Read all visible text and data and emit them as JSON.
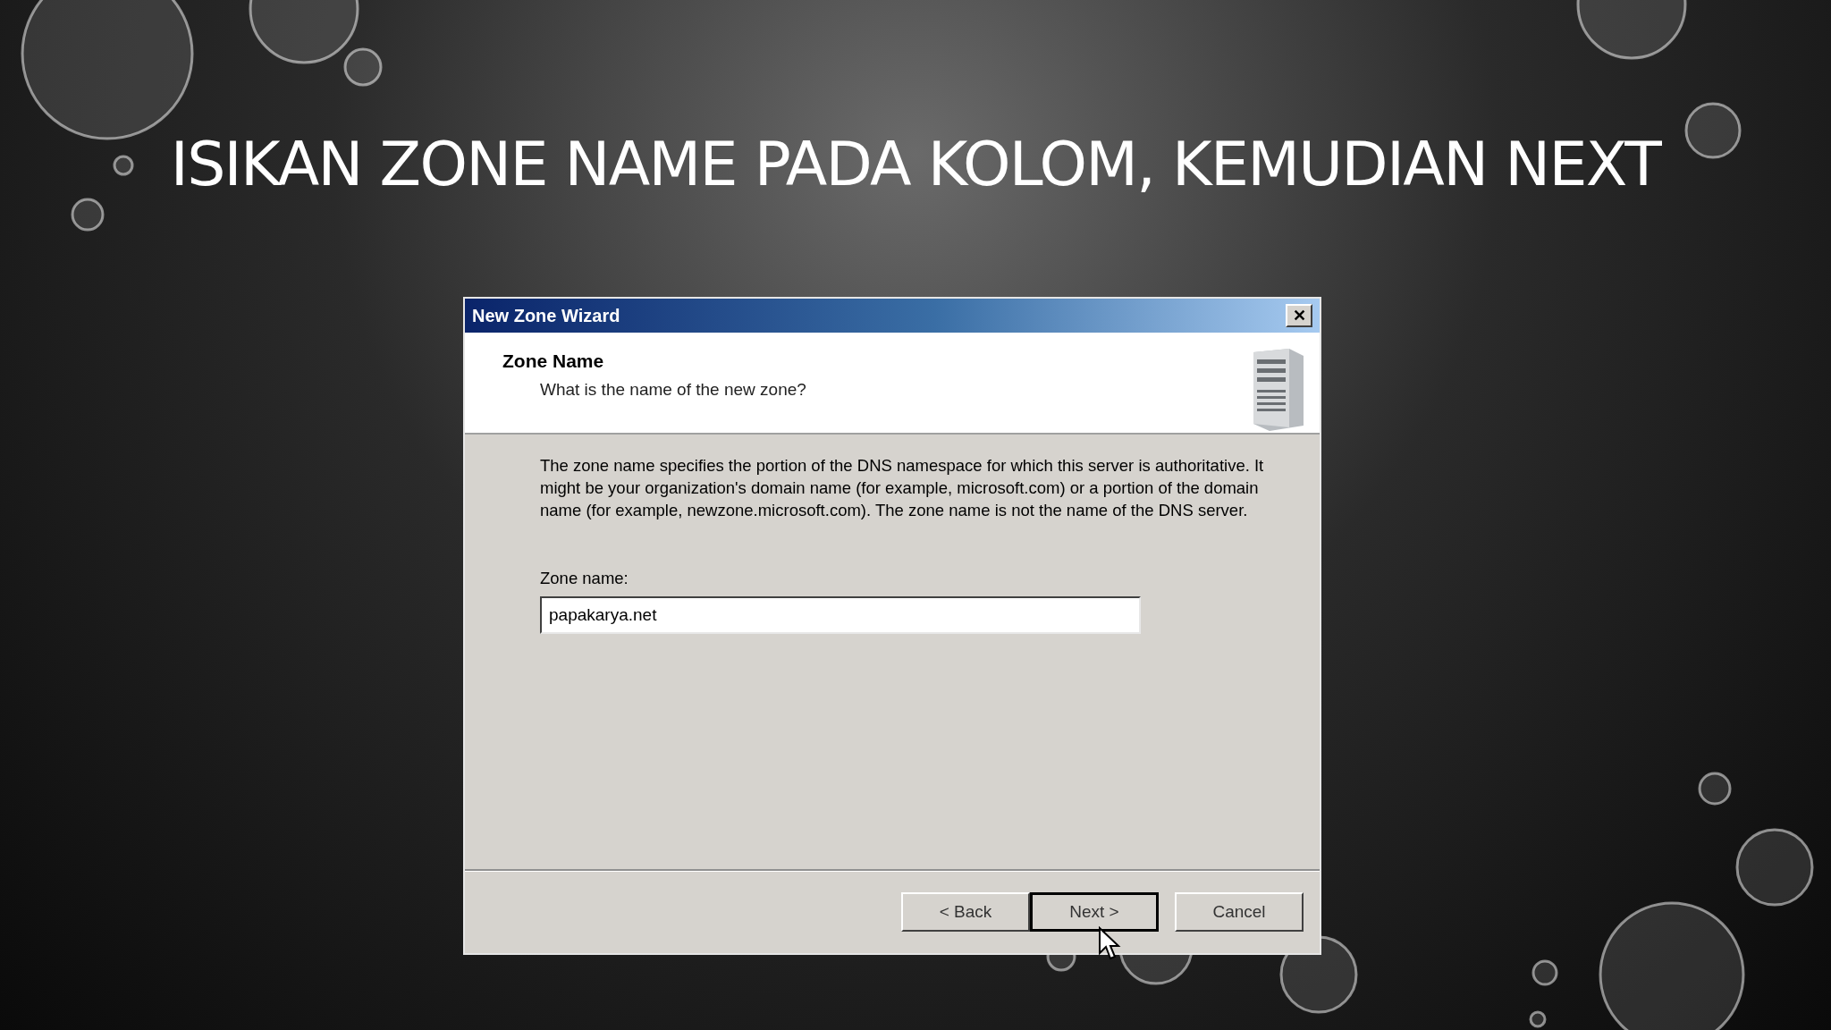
{
  "slide_title": "ISIKAN ZONE NAME PADA KOLOM, KEMUDIAN NEXT",
  "window": {
    "title": "New Zone Wizard",
    "close": "✕"
  },
  "header": {
    "title": "Zone Name",
    "subtitle": "What is the name of the new zone?"
  },
  "description": "The zone name specifies the portion of the DNS namespace for which this server is authoritative. It might be your organization's domain name (for example,  microsoft.com) or a portion of the domain name (for example, newzone.microsoft.com). The zone name is not the name of the DNS server.",
  "zone_name": {
    "label": "Zone name:",
    "value": "papakarya.net"
  },
  "buttons": [
    {
      "label": "< Back",
      "default": false
    },
    {
      "label": "Next >",
      "default": true
    },
    {
      "label": "Cancel",
      "default": false
    }
  ]
}
